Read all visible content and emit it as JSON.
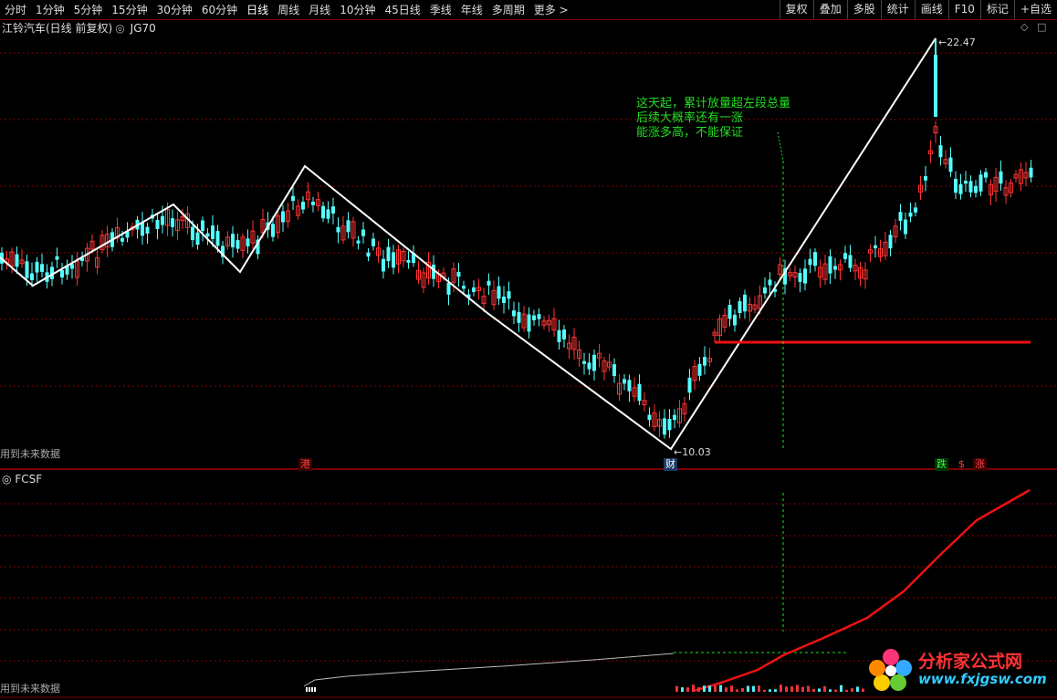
{
  "toolbar": {
    "periods": [
      "分时",
      "1分钟",
      "5分钟",
      "15分钟",
      "30分钟",
      "60分钟",
      "日线",
      "周线",
      "月线",
      "10分钟",
      "45日线",
      "季线",
      "年线",
      "多周期",
      "更多 >"
    ],
    "active_period": "日线",
    "right_buttons": [
      "复权",
      "叠加",
      "多股",
      "统计",
      "画线",
      "F10",
      "标记",
      "+自选"
    ]
  },
  "chart_header": {
    "stock_name": "江铃汽车(日线 前复权)",
    "indicator": "JG70"
  },
  "annotation": {
    "line1": "这天起，累计放量超左段总量",
    "line2": "后续大概率还有一涨",
    "line3": "能涨多高，不能保证"
  },
  "price_labels": {
    "high": "22.47",
    "low": "10.03"
  },
  "tags": {
    "gang": "港",
    "cai": "财",
    "die": "跌",
    "s": "$",
    "zhang": "涨"
  },
  "footnotes": {
    "main": "用到未来数据",
    "sub": "用到未来数据"
  },
  "sub_indicator": "FCSF",
  "corner_icons": [
    "diamond-icon",
    "square-icon"
  ],
  "watermark": {
    "title": "分析家公式网",
    "url": "www.fxjgsw.com"
  },
  "colors": {
    "up": "#ff3333",
    "down": "#54ffff",
    "zigzag": "#ffffff",
    "annotation": "#22dd22",
    "support": "#ee1111"
  }
}
